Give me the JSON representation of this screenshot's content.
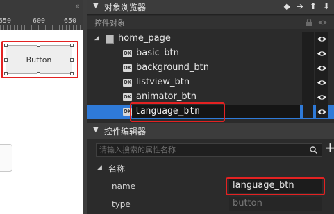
{
  "canvas": {
    "ruler_ticks": [
      "650",
      "600",
      "650"
    ],
    "button_label": "Button"
  },
  "object_browser": {
    "title": "对象浏览器",
    "subheader": "控件对象",
    "root": "home_page",
    "items": [
      "basic_btn",
      "background_btn",
      "listview_btn",
      "animator_btn"
    ],
    "editing_item": "language_btn"
  },
  "control_editor": {
    "title": "控件编辑器",
    "search_placeholder": "请输入搜索的属性名称",
    "group_title": "名称",
    "properties": [
      {
        "label": "name",
        "value": "language_btn"
      },
      {
        "label": "type",
        "value": "button"
      }
    ]
  },
  "colors": {
    "highlight_red": "#e32222",
    "selection_blue": "#2f7ad8",
    "panel_bg": "#2b2b2b"
  }
}
